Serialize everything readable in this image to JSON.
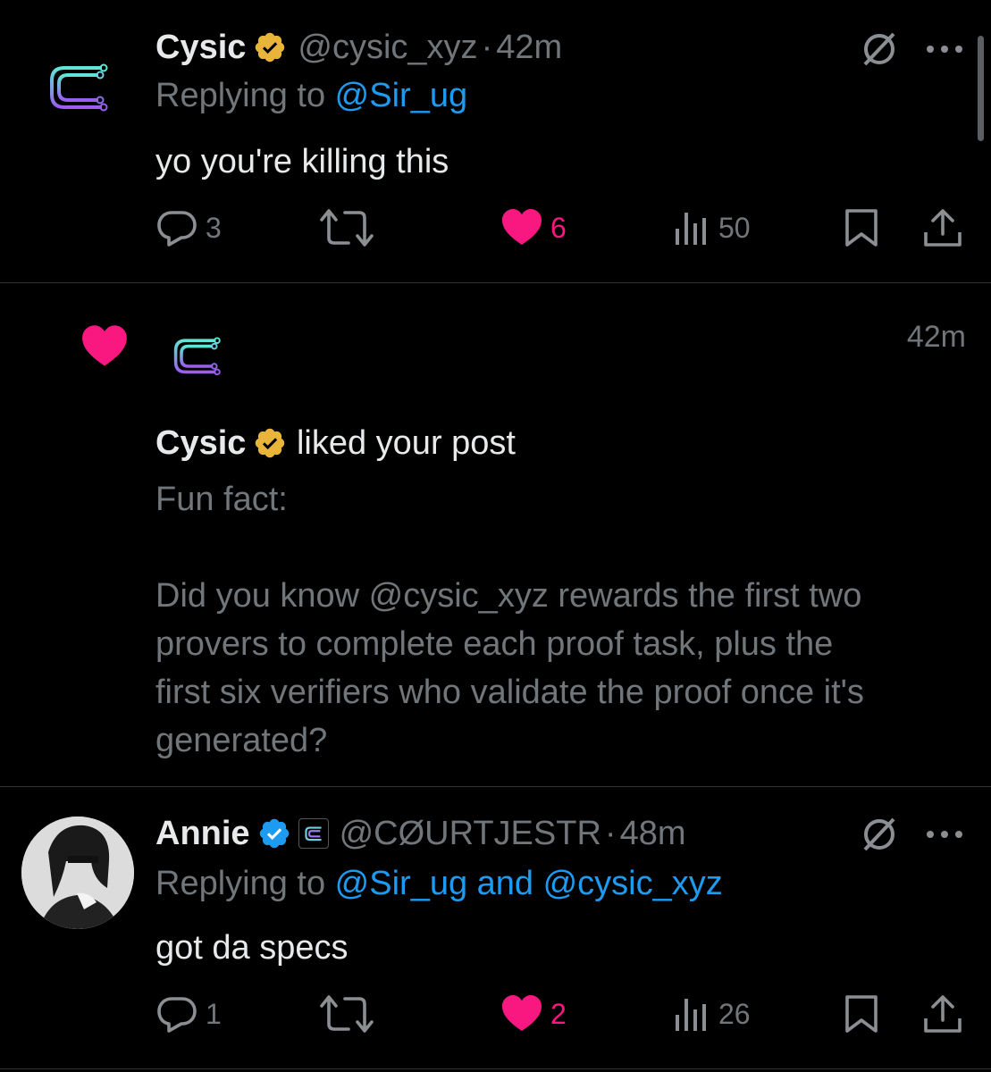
{
  "tweet1": {
    "name": "Cysic",
    "handle": "@cysic_xyz",
    "sep": "·",
    "time": "42m",
    "replying_prefix": "Replying to ",
    "replying_to": "@Sir_ug",
    "text": "yo you're killing this",
    "replies": "3",
    "likes": "6",
    "views": "50",
    "liked": true
  },
  "notification": {
    "time": "42m",
    "name": "Cysic",
    "action": " liked your post",
    "post_lines": [
      "Fun fact:",
      "",
      "Did you know @cysic_xyz rewards the first two",
      "provers to complete each proof task, plus the",
      "first six verifiers who validate the proof once it's",
      "generated?"
    ]
  },
  "tweet2": {
    "name": "Annie",
    "handle": "@CØURTJESTR",
    "sep": "·",
    "time": "48m",
    "replying_prefix": "Replying to ",
    "replying_to": "@Sir_ug and @cysic_xyz",
    "text": "got da specs",
    "replies": "1",
    "likes": "2",
    "views": "26",
    "liked": true
  },
  "colors": {
    "background": "#000000",
    "text": "#e7e9ea",
    "muted": "#71767b",
    "link": "#1d9bf0",
    "like": "#f91880",
    "gold_badge": "#e8b53a",
    "blue_badge": "#1d9bf0"
  },
  "icons": [
    "cysic-logo",
    "gold-verified-badge",
    "blue-verified-badge",
    "grok-icon",
    "more-icon",
    "reply-icon",
    "retweet-icon",
    "heart-icon",
    "views-icon",
    "bookmark-icon",
    "share-icon"
  ]
}
